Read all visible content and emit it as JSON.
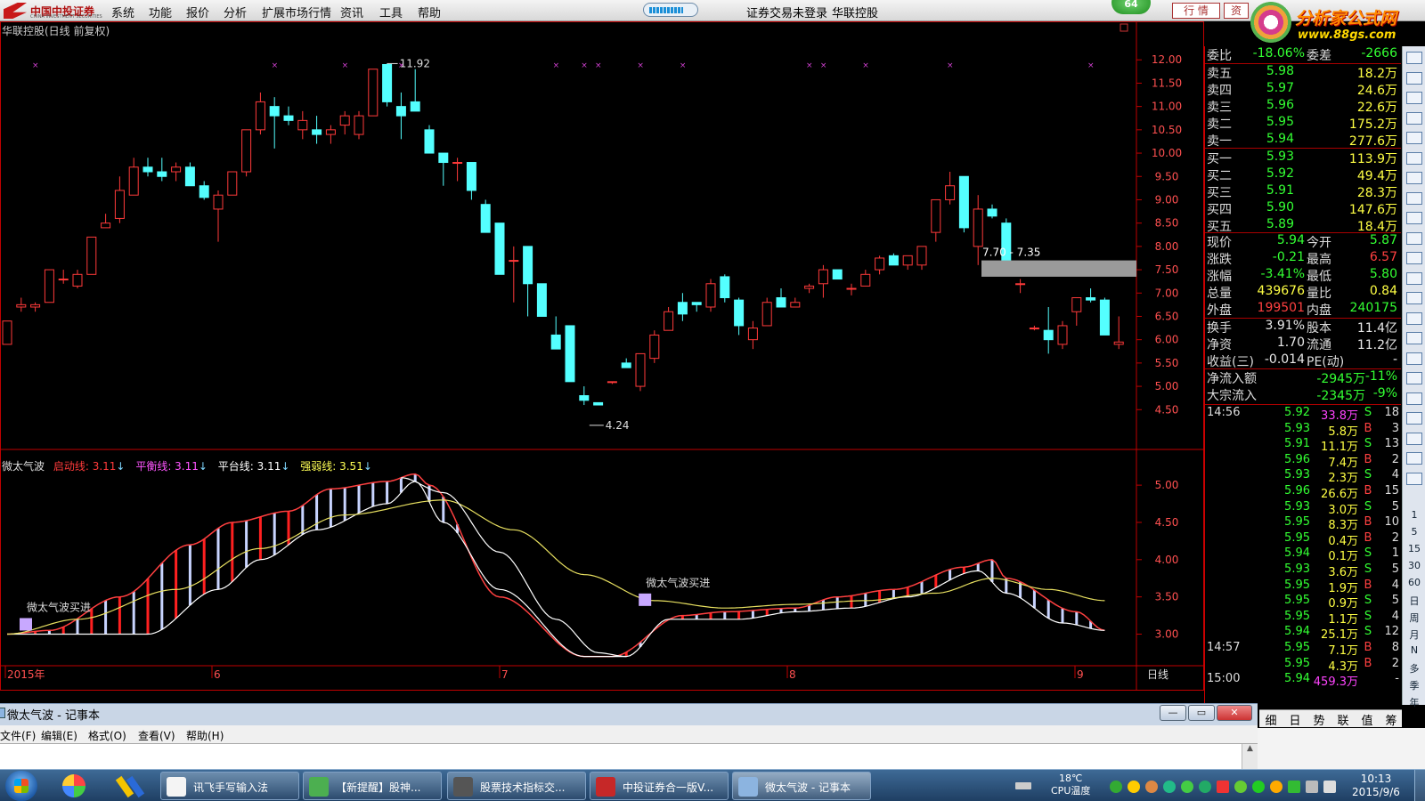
{
  "topbar": {
    "logo_text": "中国中投证券",
    "logo_sub": "CHINA INVESTMENT SECURITIES",
    "menu": [
      "系统",
      "功能",
      "报价",
      "分析",
      "扩展市场行情",
      "资讯",
      "工具",
      "帮助"
    ],
    "progress_fraction": 0.75,
    "status_text": "证券交易未登录",
    "stock_name": "华联控股",
    "circle_number": "64",
    "tab_quote": "行 情",
    "tab_info": "资",
    "brand_main": "分析家公式网",
    "brand_url": "www.88gs.com"
  },
  "chart": {
    "title": "华联控股(日线 前复权)",
    "price_axis": [
      "12.00",
      "11.50",
      "11.00",
      "10.50",
      "10.00",
      "9.50",
      "9.00",
      "8.50",
      "8.00",
      "7.50",
      "7.00",
      "6.50",
      "6.00",
      "5.50",
      "5.00",
      "4.50"
    ],
    "high_label": "11.92",
    "low_label": "4.24",
    "zone_label": "7.70 - 7.35",
    "indicator_axis": [
      "5.00",
      "4.50",
      "4.00",
      "3.50",
      "3.00"
    ],
    "x_labels": [
      "2015年",
      "6",
      "7",
      "8",
      "9"
    ],
    "period_label": "日线",
    "buy_signal_label": "微太气波买进",
    "legend": {
      "name": "微太气波",
      "l1": "启动线: 3.11",
      "l2": "平衡线: 3.11",
      "l3": "平台线: 3.11",
      "l4": "强弱线: 3.51",
      "arrow": "↓"
    },
    "colors": {
      "up": "#ff3a3a",
      "down": "#54ffff",
      "axis": "#c00000",
      "yellow": "#e8e060",
      "bar_white": "#c8d4ff"
    }
  },
  "chart_data": {
    "type": "candlestick",
    "title": "华联控股(日线 前复权)",
    "ylim": [
      4.2,
      12.1
    ],
    "x_months": [
      "2015年",
      "6",
      "7",
      "8",
      "9"
    ],
    "candles": [
      [
        5.9,
        6.4,
        6.0,
        6.4
      ],
      [
        6.7,
        6.9,
        6.6,
        6.75
      ],
      [
        6.7,
        6.8,
        6.6,
        6.75
      ],
      [
        6.8,
        7.5,
        6.8,
        7.5
      ],
      [
        7.3,
        7.5,
        7.2,
        7.3
      ],
      [
        7.15,
        7.5,
        7.1,
        7.4
      ],
      [
        7.4,
        8.2,
        7.4,
        8.2
      ],
      [
        8.4,
        8.7,
        8.4,
        8.5
      ],
      [
        8.6,
        9.5,
        8.5,
        9.2
      ],
      [
        9.1,
        9.9,
        9.1,
        9.7
      ],
      [
        9.7,
        9.9,
        9.5,
        9.6
      ],
      [
        9.6,
        9.9,
        9.4,
        9.5
      ],
      [
        9.6,
        9.8,
        9.4,
        9.7
      ],
      [
        9.7,
        9.8,
        9.3,
        9.3
      ],
      [
        9.3,
        9.4,
        9.0,
        9.05
      ],
      [
        8.8,
        9.2,
        8.1,
        9.1
      ],
      [
        9.1,
        9.6,
        9.1,
        9.6
      ],
      [
        9.6,
        10.5,
        9.5,
        10.5
      ],
      [
        10.5,
        11.3,
        10.4,
        11.1
      ],
      [
        11.0,
        11.2,
        10.1,
        10.8
      ],
      [
        10.8,
        11.0,
        10.6,
        10.7
      ],
      [
        10.5,
        10.9,
        10.3,
        10.7
      ],
      [
        10.5,
        10.8,
        10.2,
        10.4
      ],
      [
        10.4,
        10.6,
        10.2,
        10.5
      ],
      [
        10.6,
        10.9,
        10.4,
        10.8
      ],
      [
        10.4,
        10.9,
        10.3,
        10.8
      ],
      [
        10.8,
        11.8,
        10.8,
        11.8
      ],
      [
        11.9,
        11.92,
        11.0,
        11.1
      ],
      [
        11.0,
        11.3,
        10.3,
        10.8
      ],
      [
        11.1,
        11.8,
        11.0,
        10.9
      ],
      [
        10.5,
        10.6,
        10.0,
        10.0
      ],
      [
        10.0,
        10.0,
        9.3,
        9.8
      ],
      [
        9.8,
        9.9,
        9.4,
        9.8
      ],
      [
        9.8,
        9.8,
        9.0,
        9.2
      ],
      [
        8.9,
        9.0,
        8.5,
        8.3
      ],
      [
        8.5,
        8.5,
        7.4,
        7.4
      ],
      [
        7.7,
        8.0,
        6.8,
        7.7
      ],
      [
        8.0,
        8.0,
        6.5,
        7.2
      ],
      [
        7.2,
        7.2,
        6.5,
        6.5
      ],
      [
        6.1,
        6.5,
        5.9,
        5.8
      ],
      [
        6.3,
        6.3,
        5.1,
        5.1
      ],
      [
        4.8,
        5.0,
        4.6,
        4.7
      ],
      [
        4.65,
        4.65,
        4.6,
        4.6
      ],
      [
        5.1,
        5.1,
        5.05,
        5.1
      ],
      [
        5.5,
        5.6,
        5.4,
        5.4
      ],
      [
        5.0,
        5.7,
        4.9,
        5.7
      ],
      [
        5.6,
        6.2,
        5.5,
        6.1
      ],
      [
        6.2,
        6.7,
        6.2,
        6.6
      ],
      [
        6.8,
        7.0,
        6.4,
        6.55
      ],
      [
        6.8,
        6.8,
        6.6,
        6.75
      ],
      [
        6.7,
        7.3,
        6.6,
        7.2
      ],
      [
        7.35,
        7.4,
        6.8,
        6.9
      ],
      [
        6.85,
        6.9,
        6.1,
        6.3
      ],
      [
        6.0,
        6.4,
        5.8,
        6.25
      ],
      [
        6.3,
        6.9,
        6.3,
        6.8
      ],
      [
        6.9,
        7.1,
        6.7,
        6.7
      ],
      [
        6.7,
        6.9,
        6.7,
        6.8
      ],
      [
        7.1,
        7.2,
        7.0,
        7.15
      ],
      [
        7.2,
        7.6,
        6.9,
        7.5
      ],
      [
        7.5,
        7.5,
        7.3,
        7.3
      ],
      [
        7.1,
        7.2,
        6.95,
        7.1
      ],
      [
        7.15,
        7.5,
        7.15,
        7.4
      ],
      [
        7.5,
        7.8,
        7.4,
        7.75
      ],
      [
        7.8,
        7.85,
        7.6,
        7.6
      ],
      [
        7.6,
        7.8,
        7.5,
        7.8
      ],
      [
        7.6,
        8.0,
        7.5,
        8.0
      ],
      [
        8.3,
        8.9,
        8.1,
        9.0
      ],
      [
        9.0,
        9.6,
        8.9,
        9.3
      ],
      [
        9.5,
        9.5,
        8.3,
        8.4
      ],
      [
        8.0,
        9.1,
        7.6,
        8.8
      ],
      [
        8.8,
        8.9,
        8.6,
        8.65
      ],
      [
        8.5,
        8.6,
        7.7,
        7.7
      ],
      [
        7.2,
        7.3,
        7.0,
        7.2
      ],
      [
        6.25,
        6.3,
        6.2,
        6.25
      ],
      [
        6.2,
        6.7,
        5.7,
        6.0
      ],
      [
        5.9,
        6.4,
        5.8,
        6.3
      ],
      [
        6.6,
        6.9,
        6.3,
        6.9
      ],
      [
        6.9,
        7.1,
        6.8,
        6.85
      ],
      [
        6.85,
        6.9,
        6.1,
        6.1
      ],
      [
        5.9,
        6.5,
        5.8,
        5.95
      ]
    ],
    "indicator": {
      "name": "微太气波",
      "series": [
        {
          "name": "启动线",
          "last": 3.11
        },
        {
          "name": "平衡线",
          "last": 3.11
        },
        {
          "name": "平台线",
          "last": 3.11
        },
        {
          "name": "强弱线",
          "last": 3.51
        }
      ],
      "ylim": [
        2.6,
        5.3
      ],
      "signals": [
        "微太气波买进",
        "微太气波买进"
      ]
    }
  },
  "panel": {
    "weibi": {
      "label": "委比",
      "value": "-18.06%",
      "label2": "委差",
      "value2": "-2666"
    },
    "sell": [
      {
        "label": "卖五",
        "price": "5.98",
        "vol": "18.2万"
      },
      {
        "label": "卖四",
        "price": "5.97",
        "vol": "24.6万"
      },
      {
        "label": "卖三",
        "price": "5.96",
        "vol": "22.6万"
      },
      {
        "label": "卖二",
        "price": "5.95",
        "vol": "175.2万"
      },
      {
        "label": "卖一",
        "price": "5.94",
        "vol": "277.6万"
      }
    ],
    "buy": [
      {
        "label": "买一",
        "price": "5.93",
        "vol": "113.9万"
      },
      {
        "label": "买二",
        "price": "5.92",
        "vol": "49.4万"
      },
      {
        "label": "买三",
        "price": "5.91",
        "vol": "28.3万"
      },
      {
        "label": "买四",
        "price": "5.90",
        "vol": "147.6万"
      },
      {
        "label": "买五",
        "price": "5.89",
        "vol": "18.4万"
      }
    ],
    "stats": [
      {
        "l1": "现价",
        "v1": "5.94",
        "c1": "g",
        "l2": "今开",
        "v2": "5.87",
        "c2": "g"
      },
      {
        "l1": "涨跌",
        "v1": "-0.21",
        "c1": "g",
        "l2": "最高",
        "v2": "6.57",
        "c2": "r"
      },
      {
        "l1": "涨幅",
        "v1": "-3.41%",
        "c1": "g",
        "l2": "最低",
        "v2": "5.80",
        "c2": "g"
      },
      {
        "l1": "总量",
        "v1": "439676",
        "c1": "y",
        "l2": "量比",
        "v2": "0.84",
        "c2": "y"
      },
      {
        "l1": "外盘",
        "v1": "199501",
        "c1": "r",
        "l2": "内盘",
        "v2": "240175",
        "c2": "g"
      }
    ],
    "stats2": [
      {
        "l1": "换手",
        "v1": "3.91%",
        "c1": "w",
        "l2": "股本",
        "v2": "11.4亿",
        "c2": "w"
      },
      {
        "l1": "净资",
        "v1": "1.70",
        "c1": "w",
        "l2": "流通",
        "v2": "11.2亿",
        "c2": "w"
      },
      {
        "l1": "收益(三)",
        "v1": "-0.014",
        "c1": "w",
        "l2": "PE(动)",
        "v2": "-",
        "c2": "w"
      }
    ],
    "flow": [
      {
        "label": "净流入额",
        "value": "-2945万",
        "pct": "-11%"
      },
      {
        "label": "大宗流入",
        "value": "-2345万",
        "pct": "-9%"
      }
    ],
    "ticks": [
      {
        "time": "14:56",
        "price": "5.92",
        "pc": "g",
        "vol": "33.8万",
        "vc": "m",
        "bs": "S",
        "cnt": "18"
      },
      {
        "time": "",
        "price": "5.93",
        "pc": "g",
        "vol": "5.8万",
        "vc": "y",
        "bs": "B",
        "cnt": "3"
      },
      {
        "time": "",
        "price": "5.91",
        "pc": "g",
        "vol": "11.1万",
        "vc": "y",
        "bs": "S",
        "cnt": "13"
      },
      {
        "time": "",
        "price": "5.96",
        "pc": "g",
        "vol": "7.4万",
        "vc": "y",
        "bs": "B",
        "cnt": "2"
      },
      {
        "time": "",
        "price": "5.93",
        "pc": "g",
        "vol": "2.3万",
        "vc": "y",
        "bs": "S",
        "cnt": "4"
      },
      {
        "time": "",
        "price": "5.96",
        "pc": "g",
        "vol": "26.6万",
        "vc": "y",
        "bs": "B",
        "cnt": "15"
      },
      {
        "time": "",
        "price": "5.93",
        "pc": "g",
        "vol": "3.0万",
        "vc": "y",
        "bs": "S",
        "cnt": "5"
      },
      {
        "time": "",
        "price": "5.95",
        "pc": "g",
        "vol": "8.3万",
        "vc": "y",
        "bs": "B",
        "cnt": "10"
      },
      {
        "time": "",
        "price": "5.95",
        "pc": "g",
        "vol": "0.4万",
        "vc": "y",
        "bs": "B",
        "cnt": "2"
      },
      {
        "time": "",
        "price": "5.94",
        "pc": "g",
        "vol": "0.1万",
        "vc": "y",
        "bs": "S",
        "cnt": "1"
      },
      {
        "time": "",
        "price": "5.93",
        "pc": "g",
        "vol": "3.6万",
        "vc": "y",
        "bs": "S",
        "cnt": "5"
      },
      {
        "time": "",
        "price": "5.95",
        "pc": "g",
        "vol": "1.9万",
        "vc": "y",
        "bs": "B",
        "cnt": "4"
      },
      {
        "time": "",
        "price": "5.95",
        "pc": "g",
        "vol": "0.9万",
        "vc": "y",
        "bs": "S",
        "cnt": "5"
      },
      {
        "time": "",
        "price": "5.95",
        "pc": "g",
        "vol": "1.1万",
        "vc": "y",
        "bs": "S",
        "cnt": "4"
      },
      {
        "time": "",
        "price": "5.94",
        "pc": "g",
        "vol": "25.1万",
        "vc": "y",
        "bs": "S",
        "cnt": "12"
      },
      {
        "time": "14:57",
        "price": "5.95",
        "pc": "g",
        "vol": "7.1万",
        "vc": "y",
        "bs": "B",
        "cnt": "8"
      },
      {
        "time": "",
        "price": "5.95",
        "pc": "g",
        "vol": "4.3万",
        "vc": "y",
        "bs": "B",
        "cnt": "2"
      },
      {
        "time": "15:00",
        "price": "5.94",
        "pc": "g",
        "vol": "459.3万",
        "vc": "m",
        "bs": "",
        "cnt": "-"
      }
    ],
    "bottom_tabs": [
      "细",
      "日",
      "势",
      "联",
      "值",
      "筹"
    ]
  },
  "sidetb": {
    "labels": [
      "1",
      "5",
      "15",
      "30",
      "60",
      "日",
      "周",
      "月",
      "N",
      "多",
      "季",
      "年"
    ]
  },
  "notepad": {
    "title": "微太气波 - 记事本",
    "menu": [
      "文件(F)",
      "编辑(E)",
      "格式(O)",
      "查看(V)",
      "帮助(H)"
    ],
    "min": "—",
    "max": "▭",
    "close": "✕"
  },
  "taskbar": {
    "tasks": [
      {
        "label": "讯飞手写输入法",
        "color": "#f4f4f4"
      },
      {
        "label": "【新提醒】股神...",
        "color": "#4caf50"
      },
      {
        "label": "股票技术指标交...",
        "color": "#555"
      },
      {
        "label": "中投证券合一版V...",
        "color": "#c62828"
      },
      {
        "label": "微太气波 - 记事本",
        "color": "#8cb4e0"
      }
    ],
    "temp": "18℃",
    "cpu": "CPU温度",
    "time": "10:13",
    "date": "2015/9/6"
  }
}
